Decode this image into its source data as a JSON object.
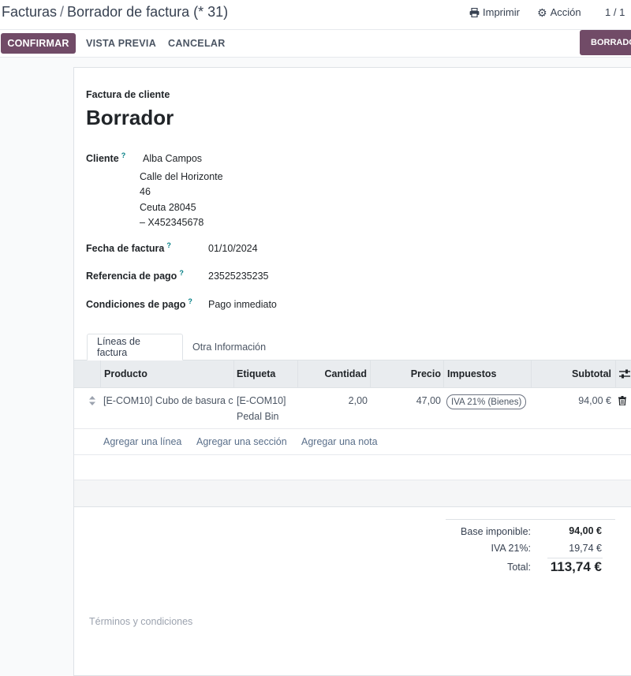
{
  "breadcrumb": {
    "parent": "Facturas",
    "separator": "/",
    "current": "Borrador de factura (* 31)"
  },
  "topbar": {
    "print_label": "Imprimir",
    "action_label": "Acción",
    "pager": "1 / 1"
  },
  "actions": {
    "confirm": "CONFIRMAR",
    "preview": "VISTA PREVIA",
    "cancel": "CANCELAR"
  },
  "statusbar": {
    "draft": "BORRADOR"
  },
  "form": {
    "type_label": "Factura de cliente",
    "title": "Borrador",
    "customer_label": "Cliente",
    "customer_name": "Alba Campos",
    "address": [
      "Calle del Horizonte",
      "46",
      "Ceuta 28045",
      "– X452345678"
    ],
    "invoice_date_label": "Fecha de factura",
    "invoice_date": "01/10/2024",
    "payment_ref_label": "Referencia de pago",
    "payment_ref": "23525235235",
    "payment_terms_label": "Condiciones de pago",
    "payment_terms": "Pago inmediato",
    "help_mark": "?"
  },
  "tabs": {
    "lines": "Líneas de factura",
    "other": "Otra Información"
  },
  "table": {
    "headers": {
      "product": "Producto",
      "label": "Etiqueta",
      "quantity": "Cantidad",
      "price": "Precio",
      "taxes": "Impuestos",
      "subtotal": "Subtotal"
    },
    "rows": [
      {
        "product": "[E-COM10] Cubo de basura c",
        "label_line1": "[E-COM10]",
        "label_line2": "Pedal Bin",
        "quantity": "2,00",
        "price": "47,00",
        "tax": "IVA 21% (Bienes)",
        "subtotal": "94,00 €"
      }
    ],
    "add_line": "Agregar una línea",
    "add_section": "Agregar una sección",
    "add_note": "Agregar una nota"
  },
  "totals": {
    "base_label": "Base imponible:",
    "base_value": "94,00 €",
    "tax_label": "IVA 21%:",
    "tax_value": "19,74 €",
    "total_label": "Total:",
    "total_value": "113,74 €"
  },
  "terms_placeholder": "Términos y condiciones",
  "colors": {
    "primary": "#714b67",
    "link": "#017e84"
  }
}
